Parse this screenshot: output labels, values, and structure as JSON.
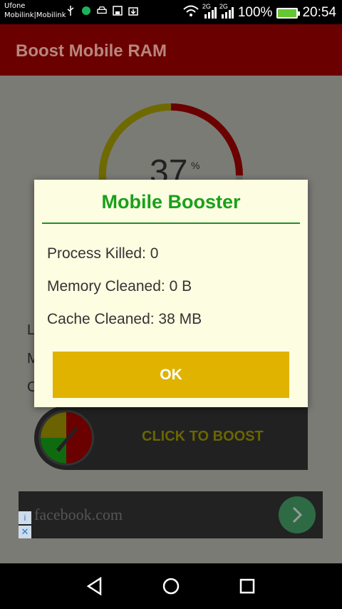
{
  "status_bar": {
    "carrier_line1": "Ufone",
    "carrier_line2": "Mobilink|Mobilink",
    "network1": "2G",
    "network2": "2G",
    "battery_percent": "100%",
    "time": "20:54",
    "icons": [
      "usb-icon",
      "vpn-icon",
      "car-icon",
      "save-icon",
      "download-icon",
      "wifi-icon",
      "signal-icon",
      "signal-icon",
      "battery-icon"
    ]
  },
  "app_bar": {
    "title": "Boost Mobile RAM"
  },
  "gauge": {
    "value": "37",
    "unit": "%",
    "level": 0.37
  },
  "boost": {
    "label": "CLICK TO BOOST"
  },
  "ad": {
    "text": "facebook.com",
    "info_icon": "info-icon",
    "close_icon": "close-icon",
    "go_icon": "chevron-right-icon"
  },
  "dialog": {
    "title": "Mobile Booster",
    "lines": [
      "Process Killed: 0",
      "Memory Cleaned: 0 B",
      "Cache Cleaned: 38 MB"
    ],
    "ok_label": "OK"
  },
  "nav": {
    "icons": [
      "back-icon",
      "home-icon",
      "recents-icon"
    ]
  },
  "colors": {
    "app_bar": "#6a0000",
    "dialog_title": "#1aa01a",
    "ok_button": "#e0b300",
    "dialog_bg": "#fdfde2"
  }
}
